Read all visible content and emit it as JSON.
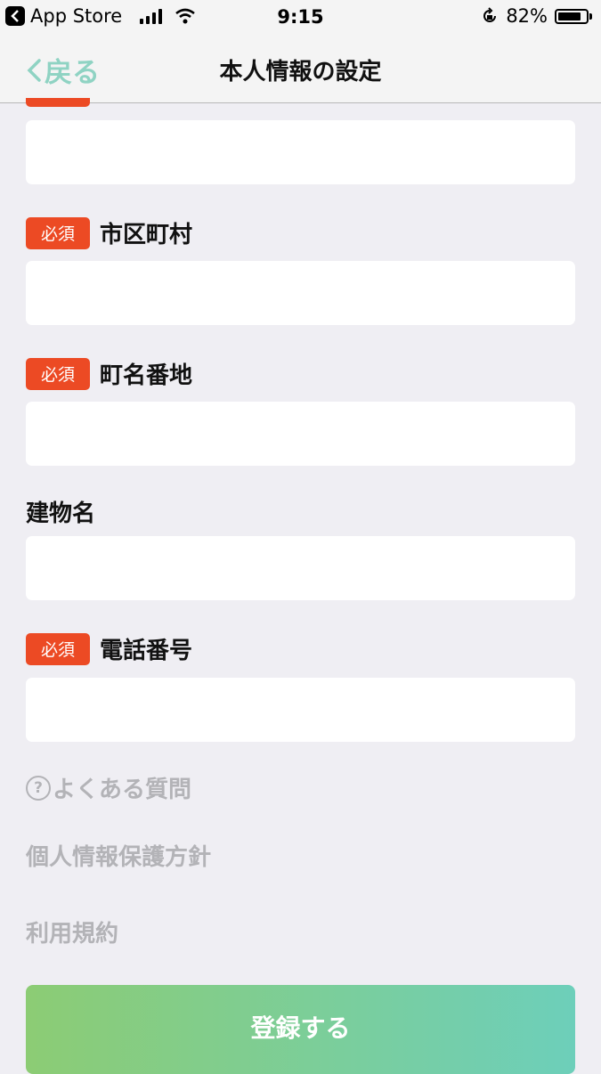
{
  "status_bar": {
    "back_app": "App Store",
    "time": "9:15",
    "battery_percent": "82%",
    "battery_level": 0.82
  },
  "nav": {
    "back_label": "戻る",
    "title": "本人情報の設定"
  },
  "form": {
    "required_badge": "必須",
    "fields": [
      {
        "label": "市区町村",
        "value": "",
        "required": true
      },
      {
        "label": "町名番地",
        "value": "",
        "required": true
      },
      {
        "label": "建物名",
        "value": "",
        "required": false
      },
      {
        "label": "電話番号",
        "value": "",
        "required": true
      }
    ]
  },
  "links": {
    "faq": "よくある質問",
    "privacy": "個人情報保護方針",
    "terms": "利用規約"
  },
  "submit_label": "登録する",
  "colors": {
    "accent": "#8fd3c3",
    "required": "#ec4a24",
    "button_start": "#8ccc74",
    "button_end": "#6dcfba"
  }
}
